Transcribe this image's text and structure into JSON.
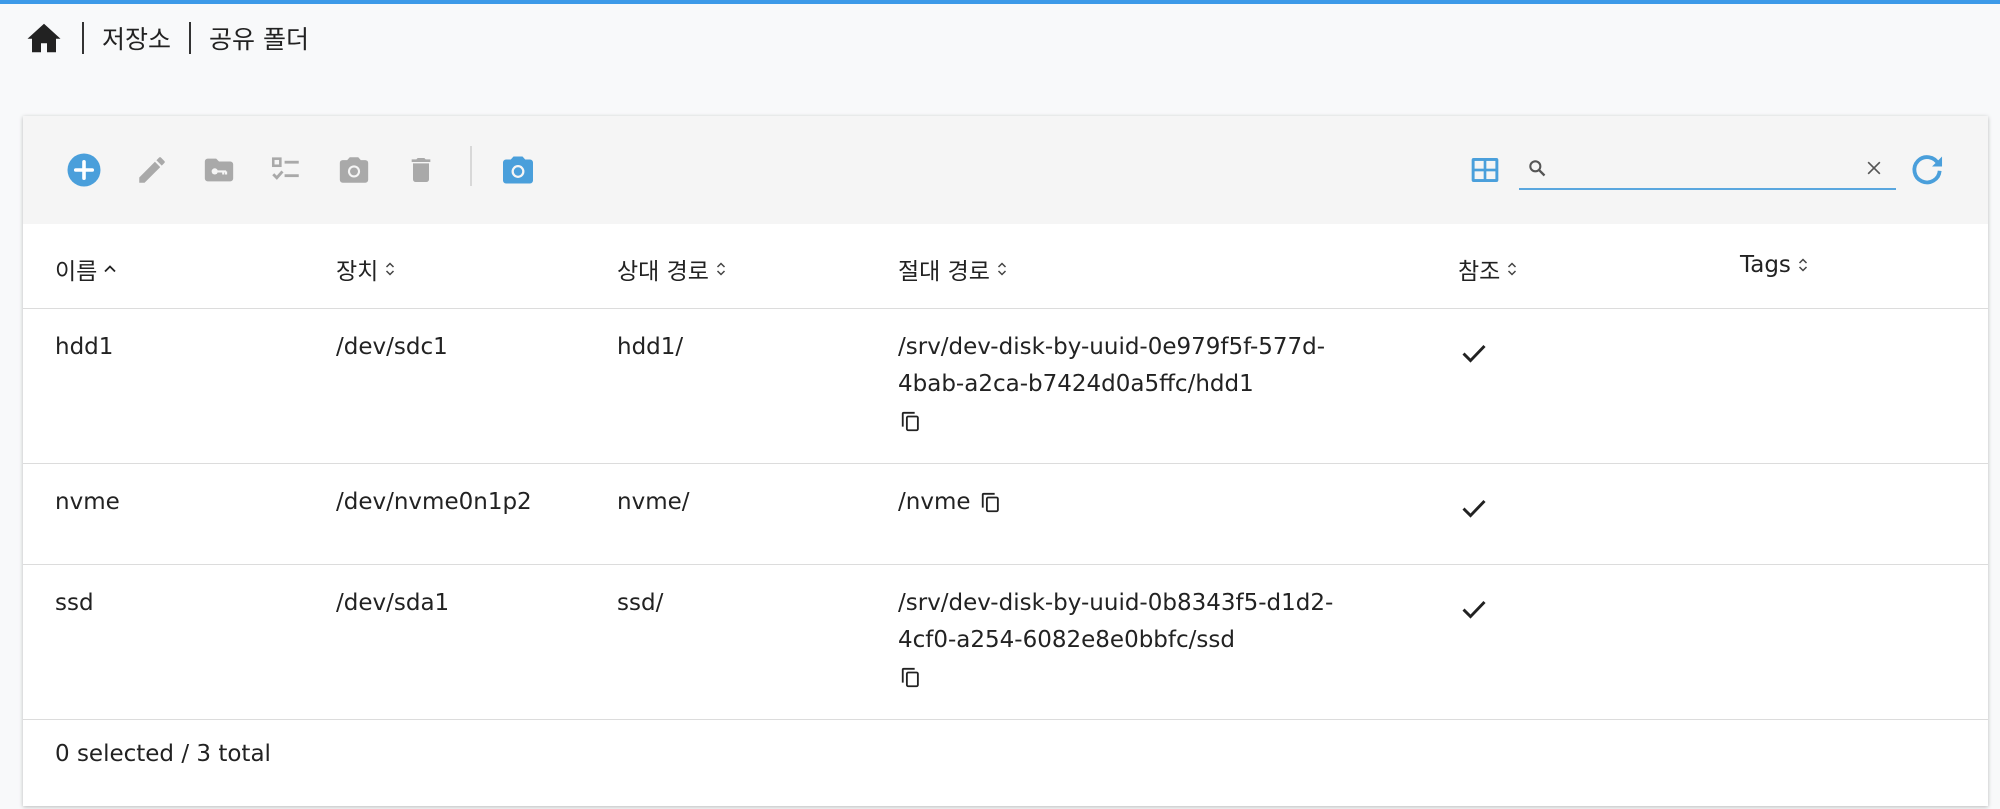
{
  "breadcrumb": {
    "home_icon": "home-icon",
    "items": [
      "저장소",
      "공유 폴더"
    ]
  },
  "toolbar": {
    "icons": [
      "add-icon",
      "edit-icon",
      "folder-key-icon",
      "checklist-icon",
      "snapshot-icon",
      "delete-icon",
      "camera-icon"
    ],
    "view_icon": "table-view-icon",
    "refresh_icon": "refresh-icon",
    "search": {
      "placeholder": "",
      "value": ""
    }
  },
  "table": {
    "columns": [
      {
        "label": "이름",
        "sort": "asc"
      },
      {
        "label": "장치",
        "sort": "none"
      },
      {
        "label": "상대 경로",
        "sort": "none"
      },
      {
        "label": "절대 경로",
        "sort": "none"
      },
      {
        "label": "참조",
        "sort": "none"
      },
      {
        "label": "Tags",
        "sort": "none"
      }
    ],
    "rows": [
      {
        "name": "hdd1",
        "device": "/dev/sdc1",
        "relpath": "hdd1/",
        "abspath_line1": "/srv/dev-disk-by-uuid-0e979f5f-577d-",
        "abspath_line2": "4bab-a2ca-b7424d0a5ffc/hdd1",
        "referenced": true,
        "tags": ""
      },
      {
        "name": "nvme",
        "device": "/dev/nvme0n1p2",
        "relpath": "nvme/",
        "abspath_line1": "/nvme",
        "abspath_line2": "",
        "referenced": true,
        "tags": ""
      },
      {
        "name": "ssd",
        "device": "/dev/sda1",
        "relpath": "ssd/",
        "abspath_line1": "/srv/dev-disk-by-uuid-0b8343f5-d1d2-",
        "abspath_line2": "4cf0-a254-6082e8e0bbfc/ssd",
        "referenced": true,
        "tags": ""
      }
    ]
  },
  "footer": {
    "status": "0 selected / 3 total"
  },
  "colors": {
    "accent": "#3d9ae8",
    "icon_active": "#4a9fdb",
    "icon_disabled": "#a9a9a9"
  }
}
